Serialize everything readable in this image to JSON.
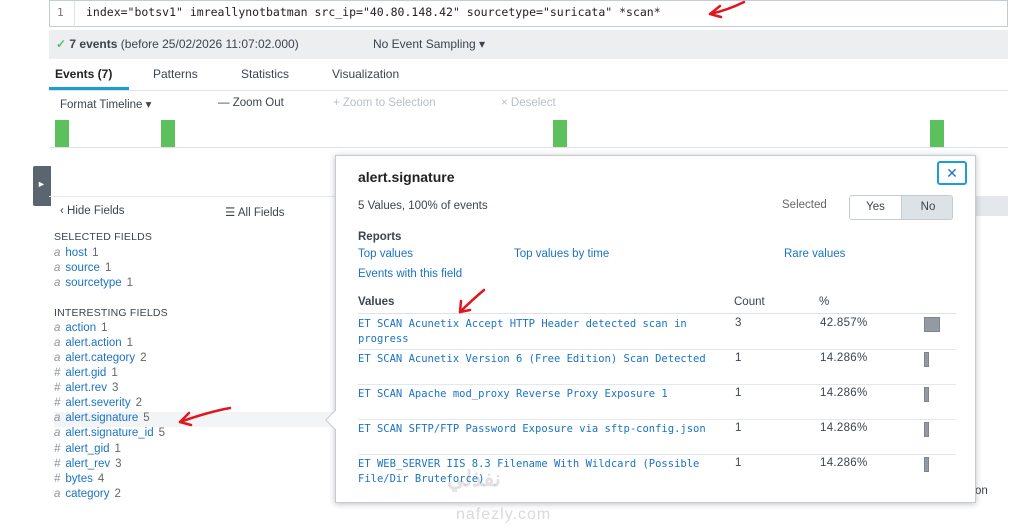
{
  "search": {
    "line_number": "1",
    "query": "index=\"botsv1\" imreallynotbatman src_ip=\"40.80.148.42\" sourcetype=\"suricata\" *scan*"
  },
  "status": {
    "check": "✓",
    "events_count": "7 events",
    "before_text": "(before 25/02/2026 11:07:02.000)",
    "sampling": "No Event Sampling ▾"
  },
  "tabs": [
    {
      "label": "Events (7)"
    },
    {
      "label": "Patterns"
    },
    {
      "label": "Statistics"
    },
    {
      "label": "Visualization"
    }
  ],
  "timeline_toolbar": {
    "format": "Format Timeline ▾",
    "zoom_out": "— Zoom Out",
    "zoom_selection": "+ Zoom to Selection",
    "deselect": "× Deselect"
  },
  "timeline_events": [
    1,
    1,
    1,
    1
  ],
  "sidebar": {
    "toggle_icon": "►",
    "hide_fields": "‹ Hide Fields",
    "all_fields": "☰ All Fields",
    "selected_title": "SELECTED FIELDS",
    "selected_fields": [
      {
        "type": "a",
        "name": "host",
        "count": "1"
      },
      {
        "type": "a",
        "name": "source",
        "count": "1"
      },
      {
        "type": "a",
        "name": "sourcetype",
        "count": "1"
      }
    ],
    "interesting_title": "INTERESTING FIELDS",
    "interesting_fields": [
      {
        "type": "a",
        "name": "action",
        "count": "1"
      },
      {
        "type": "a",
        "name": "alert.action",
        "count": "1"
      },
      {
        "type": "a",
        "name": "alert.category",
        "count": "2"
      },
      {
        "type": "#",
        "name": "alert.gid",
        "count": "1"
      },
      {
        "type": "#",
        "name": "alert.rev",
        "count": "3"
      },
      {
        "type": "#",
        "name": "alert.severity",
        "count": "2"
      },
      {
        "type": "a",
        "name": "alert.signature",
        "count": "5"
      },
      {
        "type": "a",
        "name": "alert.signature_id",
        "count": "5"
      },
      {
        "type": "#",
        "name": "alert_gid",
        "count": "1"
      },
      {
        "type": "#",
        "name": "alert_rev",
        "count": "3"
      },
      {
        "type": "#",
        "name": "bytes",
        "count": "4"
      },
      {
        "type": "a",
        "name": "category",
        "count": "2"
      }
    ]
  },
  "popup": {
    "title": "alert.signature",
    "close_icon": "✕",
    "summary": "5 Values, 100% of events",
    "selected_label": "Selected",
    "yes": "Yes",
    "no": "No",
    "reports_label": "Reports",
    "links": {
      "top_values": "Top values",
      "top_values_time": "Top values by time",
      "rare_values": "Rare values",
      "events_with_field": "Events with this field"
    },
    "columns": {
      "values": "Values",
      "count": "Count",
      "percent": "%"
    },
    "rows": [
      {
        "value": "ET SCAN Acunetix Accept HTTP Header detected scan in progress",
        "count": "3",
        "percent": "42.857%",
        "fraction": 0.42857
      },
      {
        "value": "ET SCAN Acunetix Version 6 (Free Edition) Scan Detected",
        "count": "1",
        "percent": "14.286%",
        "fraction": 0.14286
      },
      {
        "value": "ET SCAN Apache mod_proxy Reverse Proxy Exposure 1",
        "count": "1",
        "percent": "14.286%",
        "fraction": 0.14286
      },
      {
        "value": "ET SCAN SFTP/FTP Password Exposure via sftp-config.json",
        "count": "1",
        "percent": "14.286%",
        "fraction": 0.14286
      },
      {
        "value": "ET WEB_SERVER IIS 8.3 Filename With Wildcard (Possible File/Dir Bruteforce)",
        "count": "1",
        "percent": "14.286%",
        "fraction": 0.14286
      }
    ]
  },
  "background_tail": "on",
  "watermark": {
    "logo": "نفذلي",
    "site": "nafezly.com"
  },
  "colors": {
    "accent": "#1a9eda",
    "link": "#1a73c6",
    "timeline_bar": "#5cc05c",
    "annotation": "#e0181e"
  }
}
